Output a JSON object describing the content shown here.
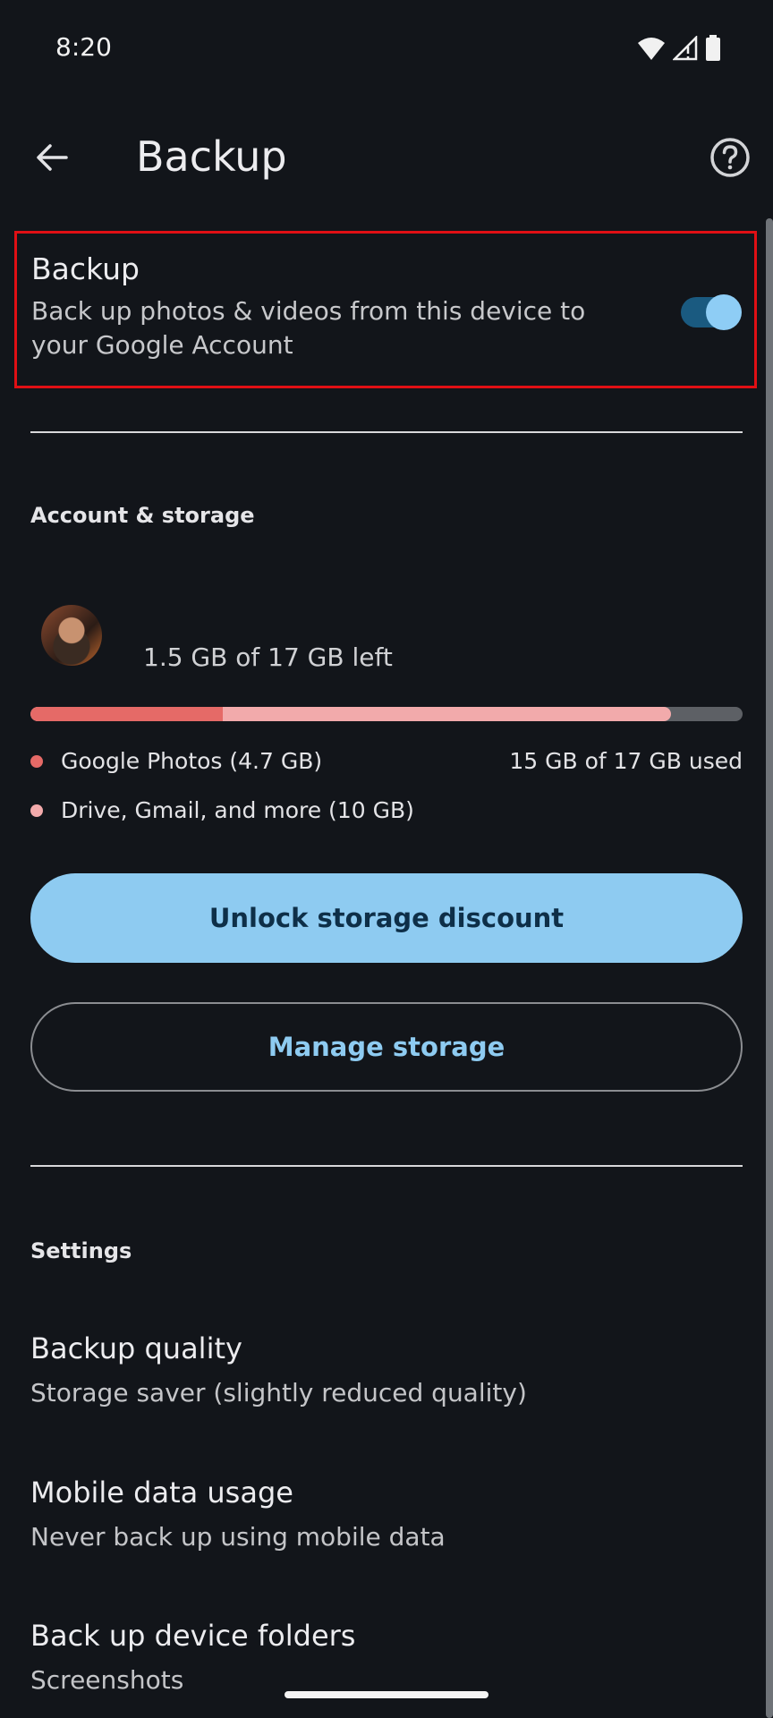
{
  "status_bar": {
    "time": "8:20",
    "icons": [
      "wifi-icon",
      "cellular-signal-icon",
      "battery-icon"
    ]
  },
  "app_bar": {
    "title": "Backup",
    "back_icon": "arrow-back-icon",
    "help_icon": "help-circle-icon"
  },
  "backup_toggle": {
    "title": "Backup",
    "description": "Back up photos & videos from this device to your Google Account",
    "enabled": true
  },
  "account_storage": {
    "section_label": "Account & storage",
    "storage_left": "1.5 GB of 17 GB left",
    "usage": {
      "total_gb": 17,
      "photos_fraction": 0.27,
      "used_fraction": 0.9
    },
    "legend": [
      {
        "label": "Google Photos (4.7 GB)",
        "color": "#e56a67"
      },
      {
        "label": "Drive, Gmail, and more (10 GB)",
        "color": "#f2aaab"
      }
    ],
    "used_text": "15 GB of 17 GB used",
    "unlock_button": "Unlock storage discount",
    "manage_button": "Manage storage"
  },
  "settings": {
    "section_label": "Settings",
    "items": [
      {
        "title": "Backup quality",
        "subtitle": "Storage saver (slightly reduced quality)"
      },
      {
        "title": "Mobile data usage",
        "subtitle": "Never back up using mobile data"
      },
      {
        "title": "Back up device folders",
        "subtitle": "Screenshots"
      }
    ]
  },
  "colors": {
    "background": "#12151a",
    "accent": "#8ecbf1",
    "highlight_border": "#e00f14",
    "photos_bar": "#e56a67",
    "other_bar": "#f2aaab"
  }
}
